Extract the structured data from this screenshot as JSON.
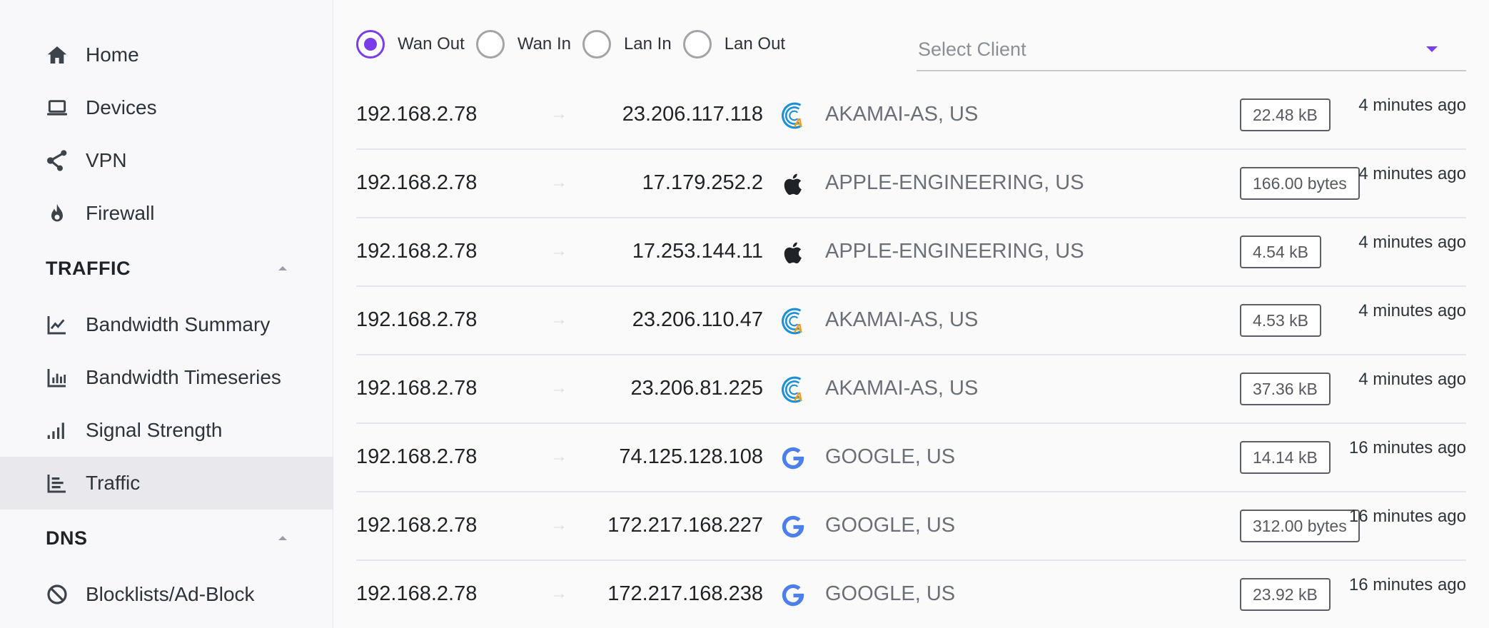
{
  "sidebar": {
    "items": [
      {
        "label": "Home",
        "icon": "home-icon"
      },
      {
        "label": "Devices",
        "icon": "laptop-icon"
      },
      {
        "label": "VPN",
        "icon": "vpn-icon"
      },
      {
        "label": "Firewall",
        "icon": "flame-icon"
      }
    ],
    "traffic_section": {
      "title": "TRAFFIC",
      "items": [
        {
          "label": "Bandwidth Summary",
          "icon": "line-chart-icon"
        },
        {
          "label": "Bandwidth Timeseries",
          "icon": "bar-chart-icon"
        },
        {
          "label": "Signal Strength",
          "icon": "signal-icon"
        },
        {
          "label": "Traffic",
          "icon": "traffic-chart-icon",
          "active": true
        }
      ]
    },
    "dns_section": {
      "title": "DNS",
      "items": [
        {
          "label": "Blocklists/Ad-Block",
          "icon": "block-icon"
        }
      ]
    }
  },
  "filters": {
    "options": [
      "Wan Out",
      "Wan In",
      "Lan In",
      "Lan Out"
    ],
    "selected": "Wan Out",
    "client_select": {
      "placeholder": "Select Client"
    }
  },
  "colors": {
    "accent": "#7a3ee6",
    "akamai_blue": "#1f8fd6",
    "akamai_orange": "#f29b1d",
    "google_blue": "#4a80e8"
  },
  "traffic": {
    "rows": [
      {
        "src": "192.168.2.78",
        "dst": "23.206.117.118",
        "logo": "akamai",
        "org": "AKAMAI-AS, US",
        "bytes": "22.48 kB",
        "time": "4 minutes ago"
      },
      {
        "src": "192.168.2.78",
        "dst": "17.179.252.2",
        "logo": "apple",
        "org": "APPLE-ENGINEERING, US",
        "bytes": "166.00 bytes",
        "time": "4 minutes ago"
      },
      {
        "src": "192.168.2.78",
        "dst": "17.253.144.11",
        "logo": "apple",
        "org": "APPLE-ENGINEERING, US",
        "bytes": "4.54 kB",
        "time": "4 minutes ago"
      },
      {
        "src": "192.168.2.78",
        "dst": "23.206.110.47",
        "logo": "akamai",
        "org": "AKAMAI-AS, US",
        "bytes": "4.53 kB",
        "time": "4 minutes ago"
      },
      {
        "src": "192.168.2.78",
        "dst": "23.206.81.225",
        "logo": "akamai",
        "org": "AKAMAI-AS, US",
        "bytes": "37.36 kB",
        "time": "4 minutes ago"
      },
      {
        "src": "192.168.2.78",
        "dst": "74.125.128.108",
        "logo": "google",
        "org": "GOOGLE, US",
        "bytes": "14.14 kB",
        "time": "16 minutes ago"
      },
      {
        "src": "192.168.2.78",
        "dst": "172.217.168.227",
        "logo": "google",
        "org": "GOOGLE, US",
        "bytes": "312.00 bytes",
        "time": "16 minutes ago"
      },
      {
        "src": "192.168.2.78",
        "dst": "172.217.168.238",
        "logo": "google",
        "org": "GOOGLE, US",
        "bytes": "23.92 kB",
        "time": "16 minutes ago"
      }
    ]
  }
}
